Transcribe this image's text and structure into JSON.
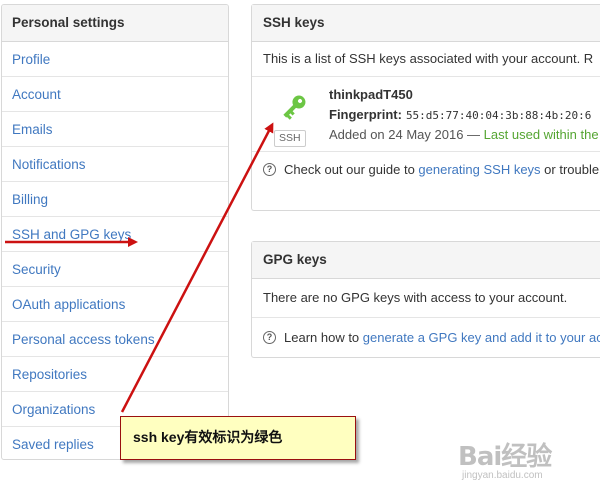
{
  "sidebar": {
    "title": "Personal settings",
    "items": [
      {
        "label": "Profile"
      },
      {
        "label": "Account"
      },
      {
        "label": "Emails"
      },
      {
        "label": "Notifications"
      },
      {
        "label": "Billing"
      },
      {
        "label": "SSH and GPG keys"
      },
      {
        "label": "Security"
      },
      {
        "label": "OAuth applications"
      },
      {
        "label": "Personal access tokens"
      },
      {
        "label": "Repositories"
      },
      {
        "label": "Organizations"
      },
      {
        "label": "Saved replies"
      }
    ]
  },
  "ssh": {
    "title": "SSH keys",
    "description": "This is a list of SSH keys associated with your account. R",
    "key": {
      "name": "thinkpadT450",
      "fingerprint_label": "Fingerprint:",
      "fingerprint": "55:d5:77:40:04:3b:88:4b:20:6",
      "added": "Added on 24 May 2016 — ",
      "last_used": "Last used within the",
      "badge": "SSH",
      "icon": "key-icon",
      "icon_color": "#6cc644"
    },
    "help_prefix": "Check out our guide to ",
    "help_link": "generating SSH keys",
    "help_suffix": " or trouble"
  },
  "gpg": {
    "title": "GPG keys",
    "description": "There are no GPG keys with access to your account.",
    "help_prefix": "Learn how to ",
    "help_link": "generate a GPG key and add it to your ac"
  },
  "annotation": {
    "text": "ssh key有效标识为绿色"
  },
  "watermark": {
    "text": "Bai经验",
    "url": "jingyan.baidu.com"
  },
  "colors": {
    "link": "#4078c0",
    "arrow": "#cc1111",
    "key_green": "#6cc644",
    "last_used_green": "#55a532"
  }
}
